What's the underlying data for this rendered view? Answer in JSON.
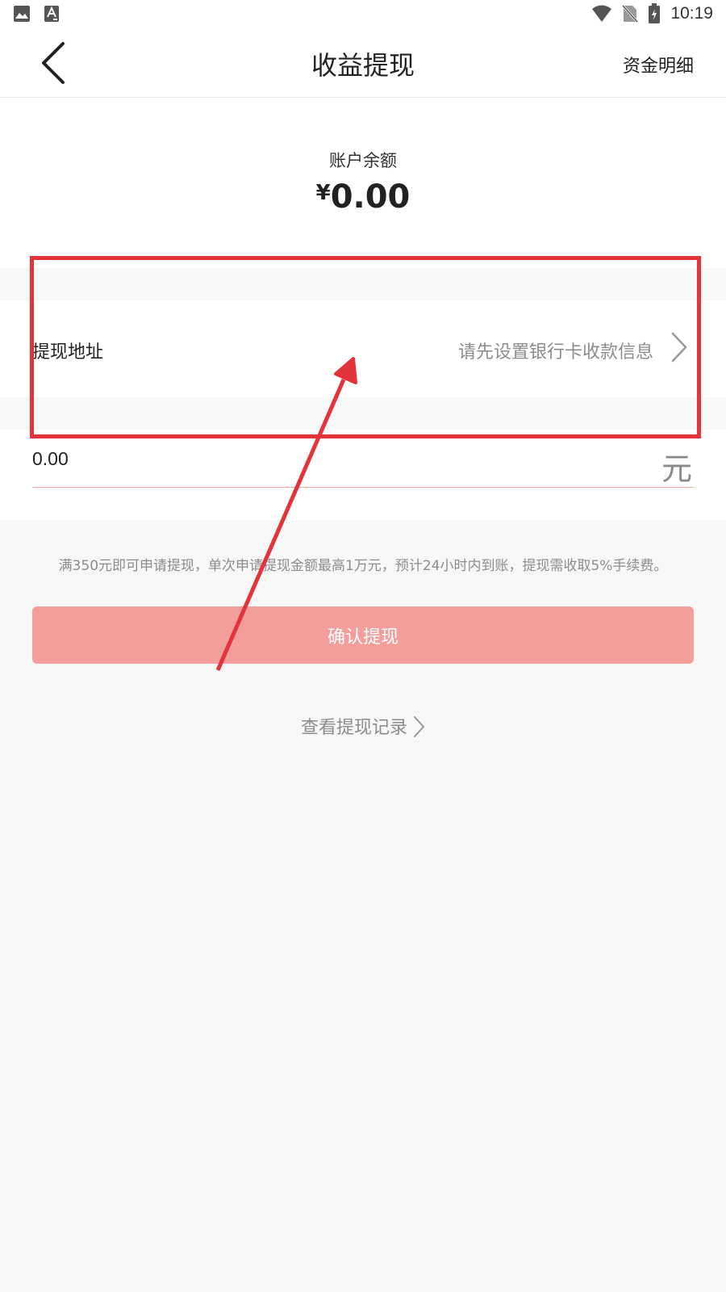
{
  "status_bar": {
    "time": "10:19",
    "left_icons": [
      "image-icon",
      "text-a-icon"
    ],
    "right_icons": [
      "wifi-icon",
      "no-sim-icon",
      "battery-charging-icon"
    ]
  },
  "header": {
    "title": "收益提现",
    "right_link": "资金明细",
    "back_icon": "chevron-left-icon"
  },
  "balance": {
    "label": "账户余额",
    "currency": "¥",
    "amount": "0.00"
  },
  "withdraw_address": {
    "label": "提现地址",
    "value": "请先设置银行卡收款信息"
  },
  "amount_input": {
    "value": "0.00",
    "unit": "元"
  },
  "notice": "满350元即可申请提现，单次申请提现金额最高1万元，预计24小时内到账，提现需收取5%手续费。",
  "confirm_button": "确认提现",
  "records_link": "查看提现记录",
  "colors": {
    "accent": "#f49e9c",
    "annotation": "#e3343c",
    "muted_text": "#8c8c8c",
    "background": "#f6f7f7"
  }
}
